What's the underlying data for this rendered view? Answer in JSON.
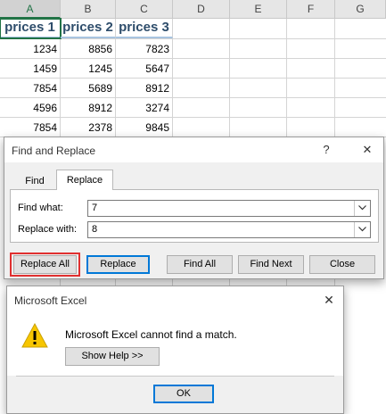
{
  "sheet": {
    "columns": [
      "A",
      "B",
      "C",
      "D",
      "E",
      "F",
      "G"
    ],
    "headers": [
      "prices 1",
      "prices 2",
      "prices 3"
    ],
    "rows": [
      [
        "1234",
        "8856",
        "7823"
      ],
      [
        "1459",
        "1245",
        "5647"
      ],
      [
        "7854",
        "5689",
        "8912"
      ],
      [
        "4596",
        "8912",
        "3274"
      ],
      [
        "7854",
        "2378",
        "9845"
      ]
    ]
  },
  "find_replace": {
    "title": "Find and Replace",
    "help": "?",
    "close": "✕",
    "tabs": [
      "Find",
      "Replace"
    ],
    "active_tab": "Replace",
    "find_label": "Find what:",
    "find_value": "7",
    "replace_label": "Replace with:",
    "replace_value": "8",
    "buttons": {
      "replace_all": "Replace All",
      "replace": "Replace",
      "find_all": "Find All",
      "find_next": "Find Next",
      "close": "Close"
    }
  },
  "message_box": {
    "title": "Microsoft Excel",
    "close": "✕",
    "message": "Microsoft Excel cannot find a match.",
    "help_button": "Show Help >>",
    "ok_button": "OK",
    "icon": "warning-icon",
    "icon_color": "#f7c600"
  },
  "colors": {
    "excel_green": "#217346",
    "highlight_red": "#e03030",
    "focus_blue": "#0078d7"
  }
}
